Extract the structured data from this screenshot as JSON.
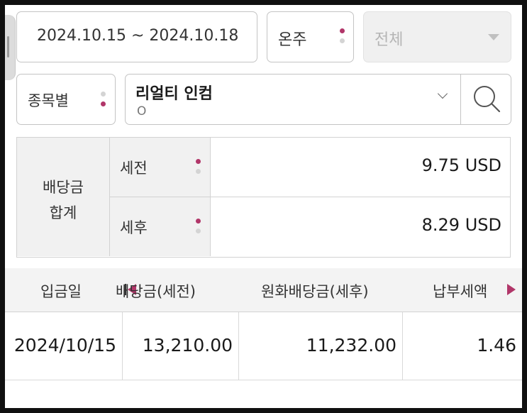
{
  "filters": {
    "date_range": "2024.10.15 ~ 2024.10.18",
    "period_select": "온주",
    "account_select": "전체",
    "view_mode": "종목별",
    "stock_name": "리얼티 인컴",
    "stock_code": "O"
  },
  "summary": {
    "heading_line1": "배당금",
    "heading_line2": "합계",
    "pre_tax_label": "세전",
    "pre_tax_value": "9.75 USD",
    "post_tax_label": "세후",
    "post_tax_value": "8.29 USD"
  },
  "table": {
    "columns": [
      "입금일",
      "배당금(세전)",
      "원화배당금(세후)",
      "납부세액"
    ],
    "rows": [
      [
        "2024/10/15",
        "13,210.00",
        "11,232.00",
        "1.46"
      ]
    ]
  },
  "colors": {
    "accent": "#b13669",
    "border": "#c4c4c4",
    "header_bg": "#f1f1f1"
  },
  "icons": [
    "search-icon",
    "chevron-down-icon",
    "caret-down-icon",
    "arrow-left-icon",
    "arrow-right-icon"
  ]
}
